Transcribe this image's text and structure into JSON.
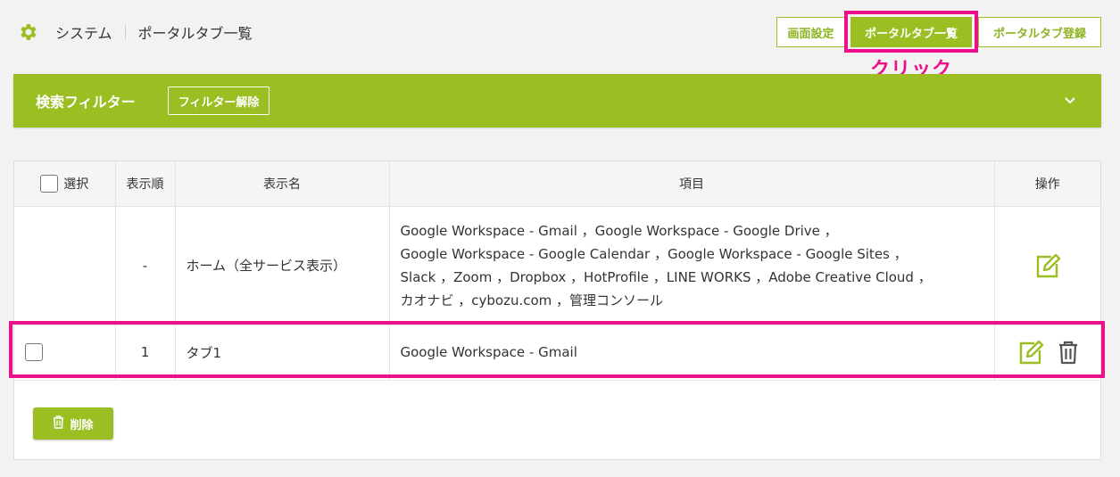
{
  "breadcrumb": {
    "root": "システム",
    "current": "ポータルタブ一覧"
  },
  "header_buttons": {
    "screen_settings": "画面設定",
    "portal_tab_list": "ポータルタブ一覧",
    "portal_tab_register": "ポータルタブ登録"
  },
  "annotation": {
    "click_label": "クリック"
  },
  "filter": {
    "title": "検索フィルター",
    "clear_button": "フィルター解除"
  },
  "table": {
    "headers": {
      "select": "選択",
      "order": "表示順",
      "name": "表示名",
      "items": "項目",
      "actions": "操作"
    },
    "rows": [
      {
        "order": "-",
        "name": "ホーム（全サービス表示）",
        "items_lines": [
          "Google Workspace - Gmail ，Google Workspace - Google Drive ，",
          "Google Workspace - Google Calendar ，Google Workspace - Google Sites ，",
          "Slack ，Zoom ，Dropbox ，HotProfile ，LINE WORKS ，Adobe Creative Cloud ，",
          "カオナビ ，cybozu.com ，管理コンソール"
        ]
      },
      {
        "order": "1",
        "name": "タブ1",
        "items": "Google Workspace - Gmail"
      }
    ]
  },
  "delete_button": "削除",
  "colors": {
    "accent": "#9bbf22",
    "highlight": "#ee0f8a"
  },
  "icons": {
    "gear": "gear-icon",
    "chevron": "chevron-down-icon",
    "edit": "edit-icon",
    "trash": "trash-icon"
  }
}
